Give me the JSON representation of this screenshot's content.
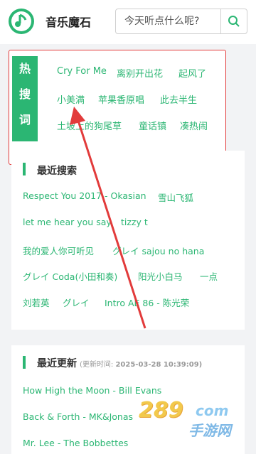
{
  "app": {
    "title": "音乐魔石"
  },
  "search": {
    "placeholder": "今天听点什么呢?"
  },
  "hot": {
    "label": [
      "热",
      "搜",
      "词"
    ],
    "tags": [
      "Cry For Me",
      "离别开出花",
      "起风了",
      "小美满",
      "苹果香原唱",
      "此去半生",
      "土坡上的狗尾草",
      "童话镇",
      "凑热闹"
    ]
  },
  "recent": {
    "title": "最近搜索",
    "items": [
      "Respect You 2017 - Okasian",
      "雪山飞狐",
      "let me hear you say",
      "tizzy t",
      "我的爱人你可听见",
      "グレイ sajou no hana",
      "グレイ Coda(小田和奏)",
      "阳光小白马",
      "一点",
      "刘若英",
      "グレイ",
      "Intro AE 86 - 陈光荣"
    ]
  },
  "updates": {
    "title": "最近更新",
    "time_label": "(更新时间:",
    "time_value": "2025-03-28 10:39:09)",
    "items": [
      "How High the Moon - Bill Evans",
      "Back & Forth - MK&Jonas",
      "Mr. Lee - The Bobbettes"
    ]
  },
  "watermark": {
    "num": "289",
    "com": "com",
    "sub": "手游网"
  },
  "colors": {
    "accent": "#2bb673",
    "highlight": "#e23b3b"
  }
}
